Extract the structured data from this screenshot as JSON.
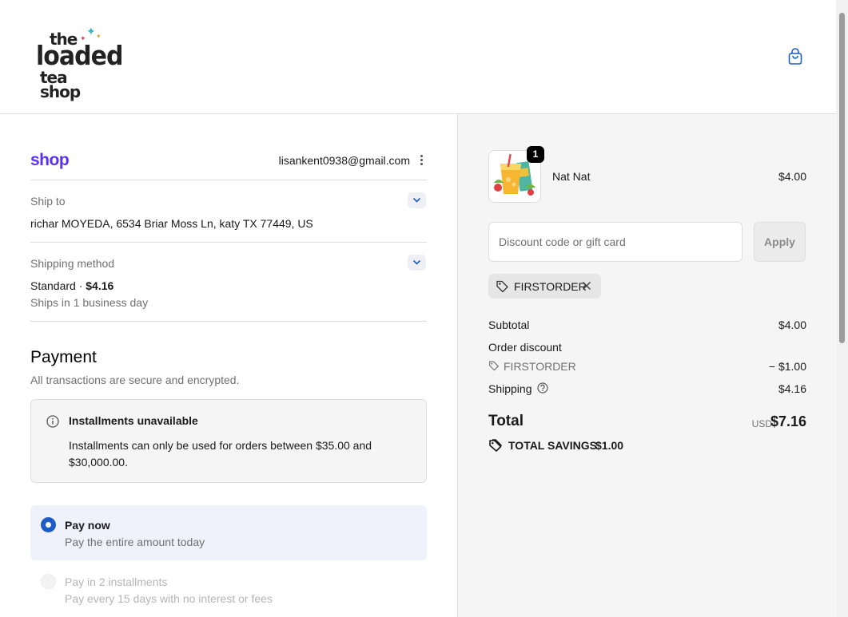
{
  "header": {
    "logo_lines": [
      "the",
      "loaded",
      "tea shop"
    ],
    "cart_icon": "shopping-bag-icon"
  },
  "account": {
    "shop_label": "shop",
    "email": "lisankent0938@gmail.com"
  },
  "ship_to": {
    "label": "Ship to",
    "value": "richar MOYEDA, 6534 Briar Moss Ln, katy TX 77449, US"
  },
  "shipping_method": {
    "label": "Shipping method",
    "value_name": "Standard · ",
    "value_price": "$4.16",
    "sub": "Ships in 1 business day"
  },
  "payment": {
    "title": "Payment",
    "subtitle": "All transactions are secure and encrypted.",
    "notice": {
      "title": "Installments unavailable",
      "body": "Installments can only be used for orders between $35.00 and $30,000.00."
    },
    "options": [
      {
        "title": "Pay now",
        "sub": "Pay the entire amount today",
        "selected": true,
        "disabled": false
      },
      {
        "title": "Pay in 2 installments",
        "sub": "Pay every 15 days with no interest or fees",
        "selected": false,
        "disabled": true
      }
    ]
  },
  "summary": {
    "item": {
      "name": "Nat Nat",
      "price": "$4.00",
      "quantity": "1"
    },
    "discount": {
      "placeholder": "Discount code or gift card",
      "apply_label": "Apply",
      "applied_code": "FIRSTORDER"
    },
    "subtotal": {
      "label": "Subtotal",
      "value": "$4.00"
    },
    "order_discount": {
      "label": "Order discount",
      "code": "FIRSTORDER",
      "value": "− $1.00"
    },
    "shipping": {
      "label": "Shipping",
      "value": "$4.16"
    },
    "total": {
      "label": "Total",
      "currency": "USD",
      "value": "$7.16"
    },
    "savings": {
      "label": "TOTAL SAVINGS",
      "value": "$1.00"
    }
  },
  "colors": {
    "accent": "#1b5cc7",
    "shop_brand": "#5a31f4",
    "summary_bg": "#f5f5f5"
  }
}
